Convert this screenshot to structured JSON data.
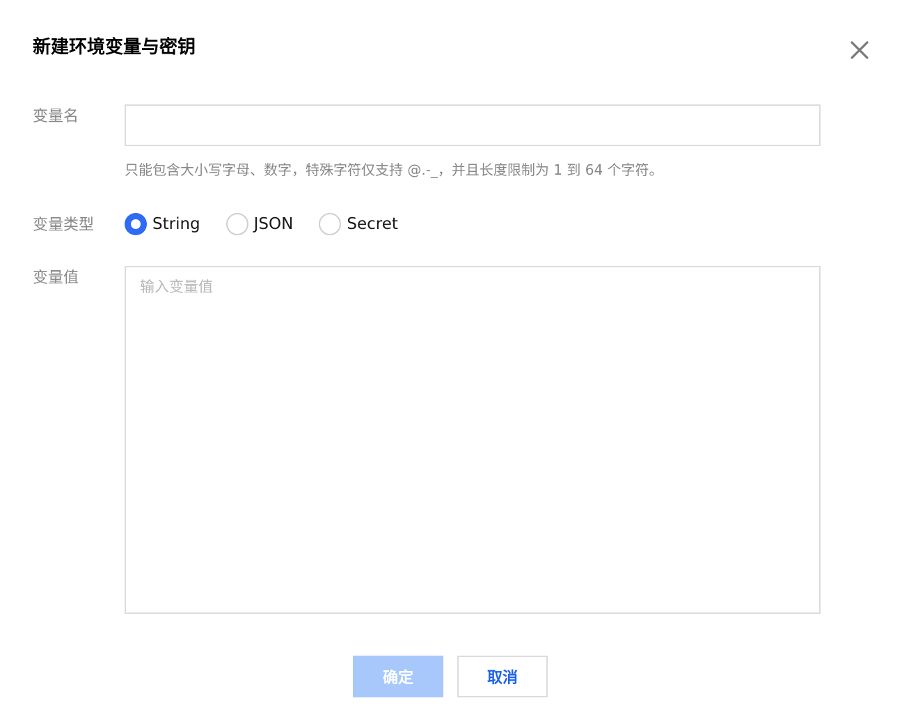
{
  "dialog": {
    "title": "新建环境变量与密钥"
  },
  "form": {
    "name_label": "变量名",
    "name_value": "",
    "name_hint": "只能包含大小写字母、数字，特殊字符仅支持 @.-_，并且长度限制为 1 到 64 个字符。",
    "type_label": "变量类型",
    "type_options": [
      {
        "label": "String",
        "checked": true
      },
      {
        "label": "JSON",
        "checked": false
      },
      {
        "label": "Secret",
        "checked": false
      }
    ],
    "value_label": "变量值",
    "value_placeholder": "输入变量值"
  },
  "footer": {
    "ok_label": "确定",
    "cancel_label": "取消"
  },
  "colors": {
    "accent": "#2f6bf4",
    "ok_disabled": "#a8c8fb",
    "cancel_text": "#1f63e8"
  }
}
